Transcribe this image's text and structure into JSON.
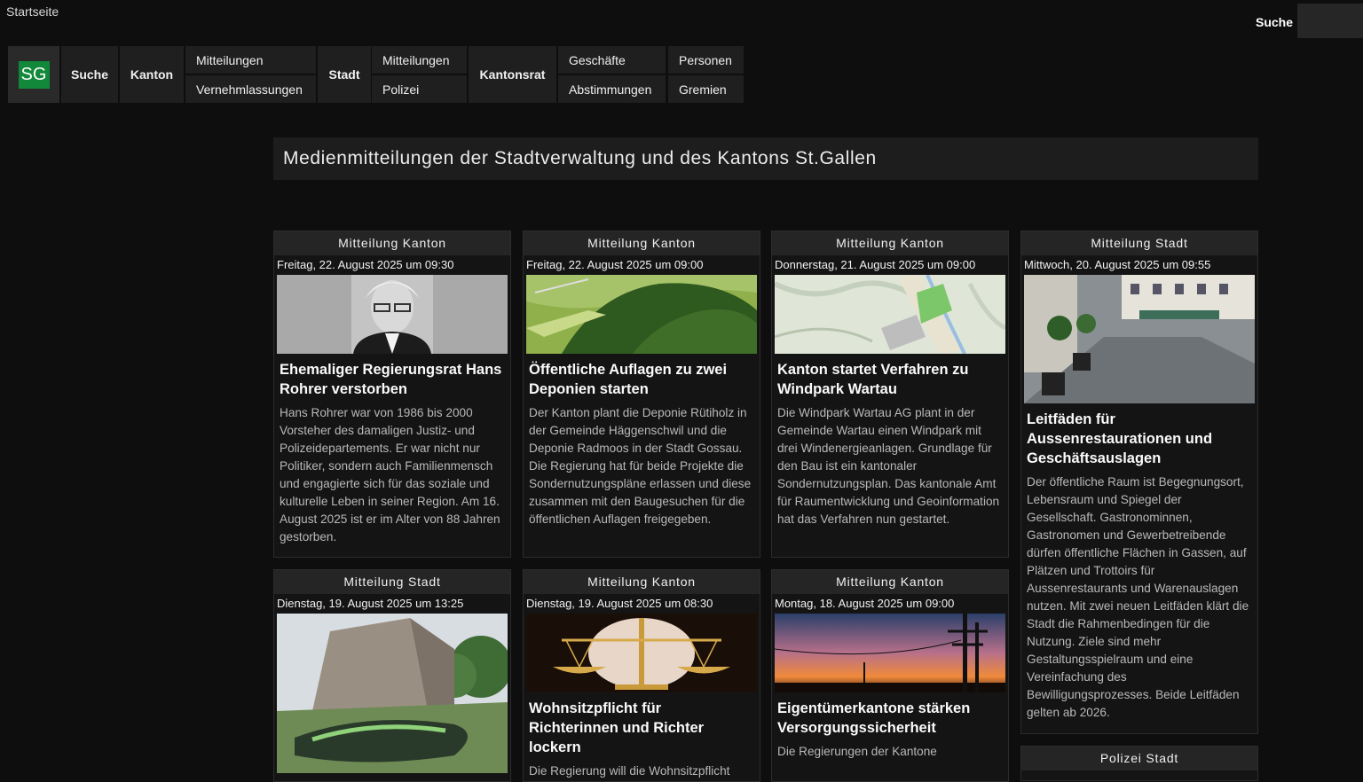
{
  "topbar": {
    "title": "Startseite",
    "search_label": "Suche"
  },
  "nav": {
    "logo": "SG",
    "suche": "Suche",
    "kanton": "Kanton",
    "kanton_sub": [
      "Mitteilungen",
      "Vernehmlassungen"
    ],
    "stadt": "Stadt",
    "stadt_sub": [
      "Mitteilungen",
      "Polizei"
    ],
    "kantonsrat": "Kantonsrat",
    "kantonsrat_sub": [
      "Geschäfte",
      "Abstimmungen",
      "Personen",
      "Gremien"
    ]
  },
  "heading": "Medienmitteilungen der Stadtverwaltung und des Kantons St.Gallen",
  "cards": [
    {
      "category": "Mitteilung Kanton",
      "date": "Freitag, 22. August 2025 um 09:30",
      "image": "portrait-photo",
      "title": "Ehemaliger Regierungsrat Hans Rohrer verstorben",
      "text": "Hans Rohrer war von 1986 bis 2000 Vorsteher des damaligen Justiz- und Polizeidepartements. Er war nicht nur Politiker, sondern auch Familienmensch und engagierte sich für das soziale und kulturelle Leben in seiner Region. Am 16. August 2025 ist er im Alter von 88 Jahren gestorben."
    },
    {
      "category": "Mitteilung Kanton",
      "date": "Freitag, 22. August 2025 um 09:00",
      "image": "aerial-landscape-photo",
      "title": "Öffentliche Auflagen zu zwei Deponien starten",
      "text": "Der Kanton plant die Deponie Rütiholz in der Gemeinde Häggenschwil und die Deponie Radmoos in der Stadt Gossau. Die Regierung hat für beide Projekte die Sondernutzungspläne erlassen und diese zusammen mit den Baugesuchen für die öffentlichen Auflagen freigegeben."
    },
    {
      "category": "Mitteilung Kanton",
      "date": "Donnerstag, 21. August 2025 um 09:00",
      "image": "map-image",
      "title": "Kanton startet Verfahren zu Windpark Wartau",
      "text": "Die Windpark Wartau AG plant in der Gemeinde Wartau einen Windpark mit drei Windenergieanlagen. Grundlage für den Bau ist ein kantonaler Sondernutzungsplan. Das kantonale Amt für Raumentwicklung und Geoinformation hat das Verfahren nun gestartet."
    },
    {
      "category": "Mitteilung Stadt",
      "date": "Mittwoch, 20. August 2025 um 09:55",
      "image": "street-photo",
      "title": "Leitfäden für Aussenrestaurationen und Geschäftsauslagen",
      "text": "Der öffentliche Raum ist Begegnungsort, Lebensraum und Spiegel der Gesellschaft. Gastronominnen, Gastronomen und Gewerbetreibende dürfen öffentliche Flächen in Gassen, auf Plätzen und Trottoirs für Aussenrestaurants und Warenauslagen nutzen. Mit zwei neuen Leitfäden klärt die Stadt die Rahmenbedingen für die Nutzung. Ziele sind mehr Gestaltungsspielraum und eine Vereinfachung des Bewilligungsprozesses. Beide Leitfäden gelten ab 2026."
    },
    {
      "category": "Mitteilung Stadt",
      "date": "Dienstag, 19. August 2025 um 13:25",
      "image": "building-photo",
      "title": "",
      "text": ""
    },
    {
      "category": "Mitteilung Kanton",
      "date": "Dienstag, 19. August 2025 um 08:30",
      "image": "scales-photo",
      "title": "Wohnsitzpflicht für Richterinnen und Richter lockern",
      "text": "Die Regierung will die Wohnsitzpflicht"
    },
    {
      "category": "Mitteilung Kanton",
      "date": "Montag, 18. August 2025 um 09:00",
      "image": "sunset-photo",
      "title": "Eigentümerkantone stärken Versorgungssicherheit",
      "text": "Die Regierungen der Kantone"
    },
    {
      "category": "Polizei Stadt",
      "date": "",
      "image": "",
      "title": "",
      "text": ""
    }
  ]
}
